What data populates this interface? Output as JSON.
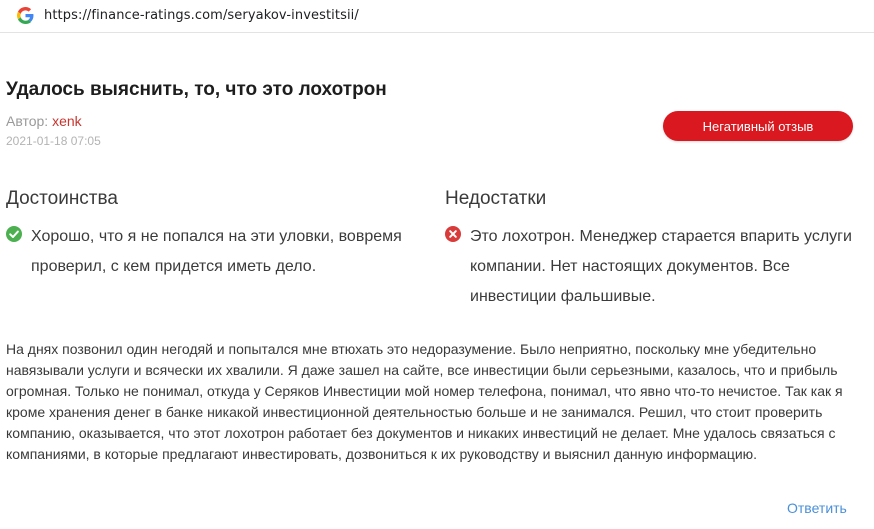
{
  "browser": {
    "url": "https://finance-ratings.com/seryakov-investitsii/"
  },
  "review": {
    "title": "Удалось выяснить, то, что это лохотрон",
    "author_label": "Автор:",
    "author_name": "xenk",
    "date": "2021-01-18 07:05",
    "negative_button": "Негативный отзыв",
    "pros_heading": "Достоинства",
    "pros_text": "Хорошо, что я не попался на эти уловки, вовремя проверил, с кем придется иметь дело.",
    "cons_heading": "Недостатки",
    "cons_text": "Это лохотрон. Менеджер старается впарить услуги компании. Нет настоящих документов. Все инвестиции фальшивые.",
    "body": "На днях позвонил один негодяй и попытался мне втюхать это недоразумение. Было неприятно, поскольку мне убедительно навязывали услуги и всячески их хвалили. Я даже зашел на сайте, все инвестиции были серьезными, казалось, что и прибыль огромная. Только не понимал, откуда у Серяков Инвестиции мой номер телефона, понимал, что явно что-то нечистое. Так как я кроме хранения денег в банке никакой инвестиционной деятельностью больше и не занимался. Решил, что стоит проверить компанию, оказывается, что этот лохотрон работает без документов и никаких инвестиций не делает. Мне удалось связаться с компаниями, в которые предлагают инвестировать, дозвониться к их руководству и выяснил данную информацию.",
    "reply_link": "Ответить"
  },
  "icons": {
    "browser": "google-g-icon",
    "pros": "check-circle-icon",
    "cons": "x-circle-icon"
  },
  "colors": {
    "accent_red": "#d9181f",
    "author_red": "#c8352e",
    "check_green": "#4caf50",
    "cross_red": "#d93a3a",
    "link_blue": "#4a90d9"
  }
}
